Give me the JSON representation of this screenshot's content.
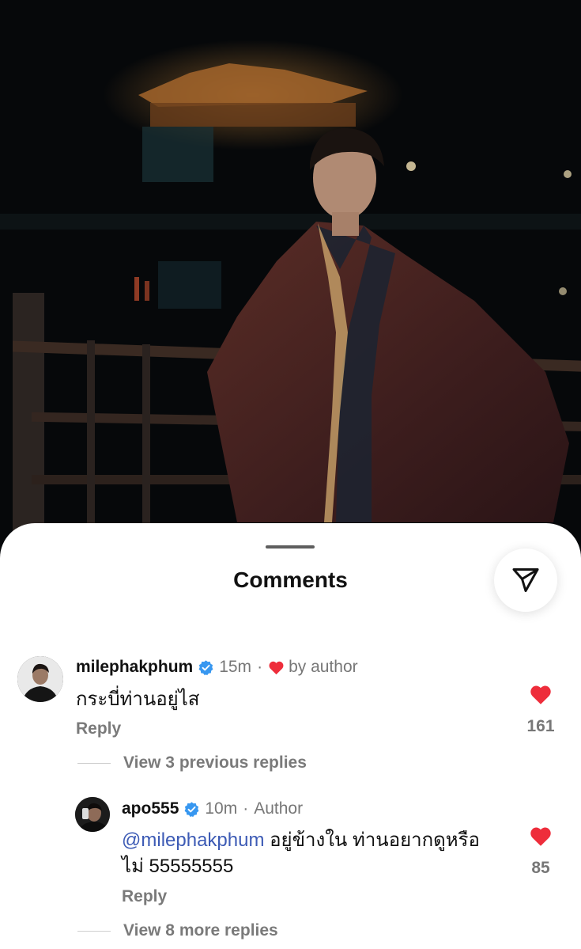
{
  "sheet": {
    "title": "Comments"
  },
  "comments": [
    {
      "username": "milephakphum",
      "time": "15m",
      "separator": "·",
      "author_like_label": "by author",
      "text": "กระบี่ท่านอยู่ไส",
      "reply_label": "Reply",
      "likes": "161",
      "view_replies_label": "View 3 previous replies"
    },
    {
      "username": "apo555",
      "time": "10m",
      "separator": "·",
      "author_label": "Author",
      "mention": "@milephakphum",
      "text_line1": " อยู่ข้างใน ท่านอยากดูหรือ",
      "text_line2": "ไม่ 55555555",
      "reply_label": "Reply",
      "likes": "85",
      "view_replies_label": "View 8 more replies"
    }
  ],
  "colors": {
    "like_red": "#ee2d3b",
    "verified_blue": "#3797f0",
    "mention_blue": "#3d5bb5"
  },
  "icons": {
    "share": "paper-plane-icon",
    "like": "heart-icon",
    "verified": "verified-badge-icon"
  }
}
